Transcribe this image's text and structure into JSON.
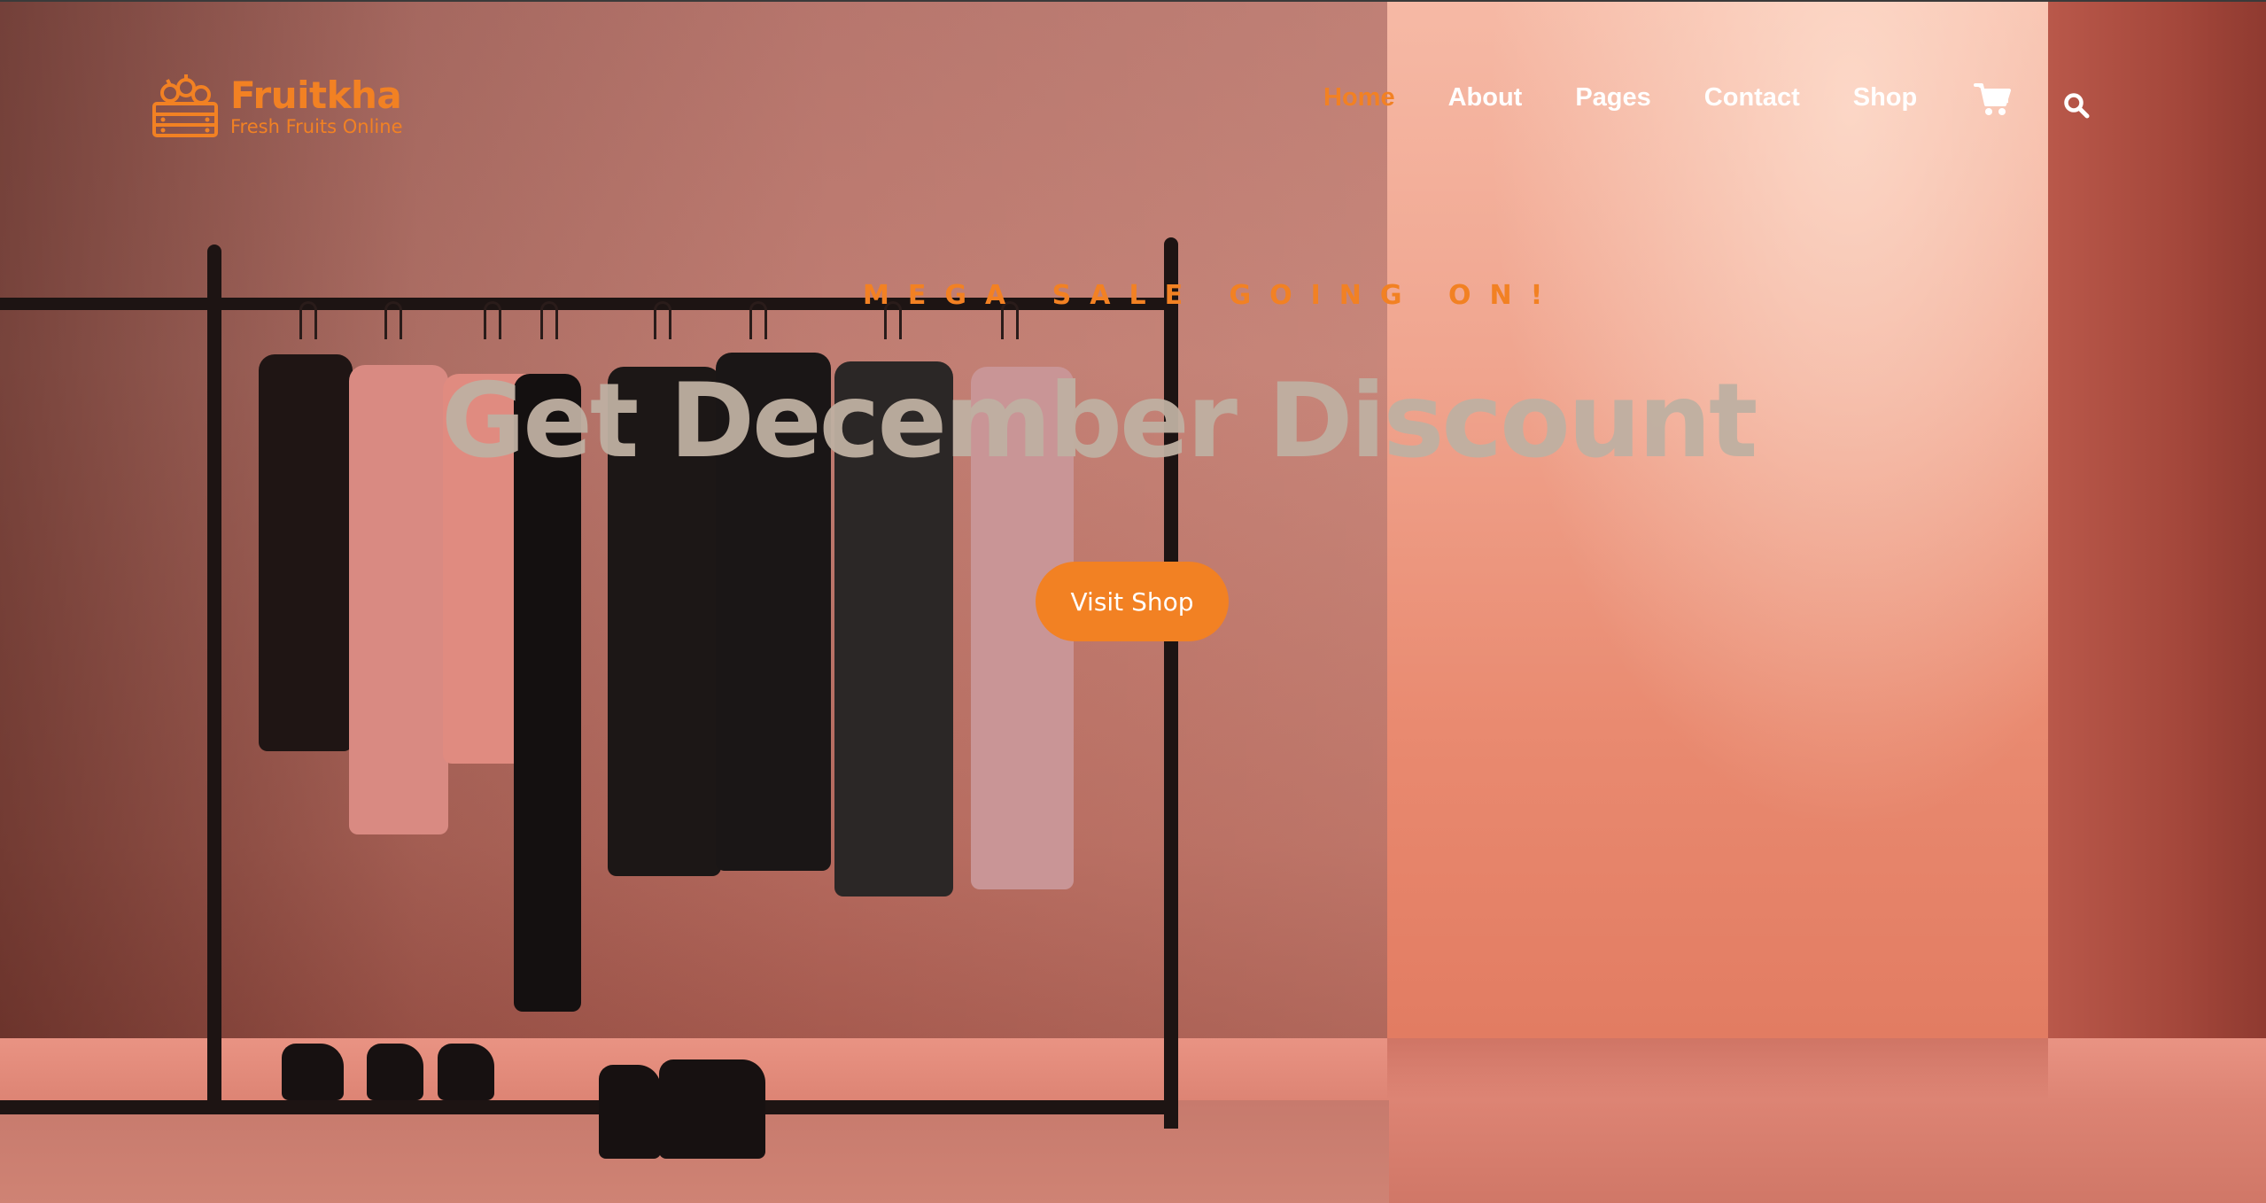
{
  "brand": {
    "name": "Fruitkha",
    "tagline": "Fresh Fruits Online",
    "icon": "fruit-basket-icon",
    "color": "#f28123"
  },
  "nav": {
    "items": [
      {
        "label": "Home",
        "active": true
      },
      {
        "label": "About",
        "active": false
      },
      {
        "label": "Pages",
        "active": false
      },
      {
        "label": "Contact",
        "active": false
      },
      {
        "label": "Shop",
        "active": false
      }
    ],
    "cart_icon": "shopping-cart-icon",
    "search_icon": "search-icon"
  },
  "hero": {
    "subtitle": "MEGA SALE GOING ON!",
    "title": "Get December Discount",
    "button_label": "Visit Shop"
  },
  "colors": {
    "accent": "#f28123",
    "title_text": "#bfb0a2",
    "nav_text": "#ffffff"
  }
}
